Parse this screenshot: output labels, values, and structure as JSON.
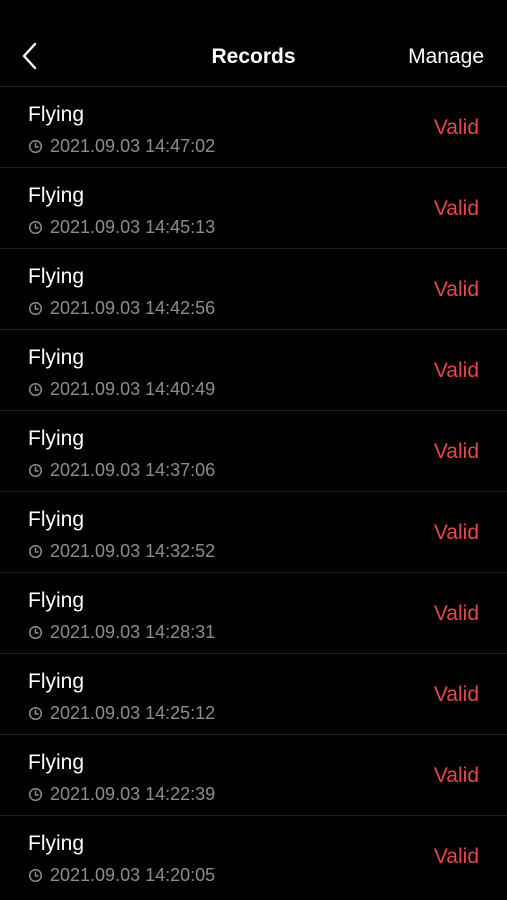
{
  "header": {
    "back_icon": "chevron-left-icon",
    "title": "Records",
    "manage_label": "Manage"
  },
  "colors": {
    "status_valid": "#e5484d",
    "meta_text": "#8d8d8d"
  },
  "records": [
    {
      "title": "Flying",
      "timestamp": "2021.09.03 14:47:02",
      "status": "Valid"
    },
    {
      "title": "Flying",
      "timestamp": "2021.09.03 14:45:13",
      "status": "Valid"
    },
    {
      "title": "Flying",
      "timestamp": "2021.09.03 14:42:56",
      "status": "Valid"
    },
    {
      "title": "Flying",
      "timestamp": "2021.09.03 14:40:49",
      "status": "Valid"
    },
    {
      "title": "Flying",
      "timestamp": "2021.09.03 14:37:06",
      "status": "Valid"
    },
    {
      "title": "Flying",
      "timestamp": "2021.09.03 14:32:52",
      "status": "Valid"
    },
    {
      "title": "Flying",
      "timestamp": "2021.09.03 14:28:31",
      "status": "Valid"
    },
    {
      "title": "Flying",
      "timestamp": "2021.09.03 14:25:12",
      "status": "Valid"
    },
    {
      "title": "Flying",
      "timestamp": "2021.09.03 14:22:39",
      "status": "Valid"
    },
    {
      "title": "Flying",
      "timestamp": "2021.09.03 14:20:05",
      "status": "Valid"
    }
  ]
}
